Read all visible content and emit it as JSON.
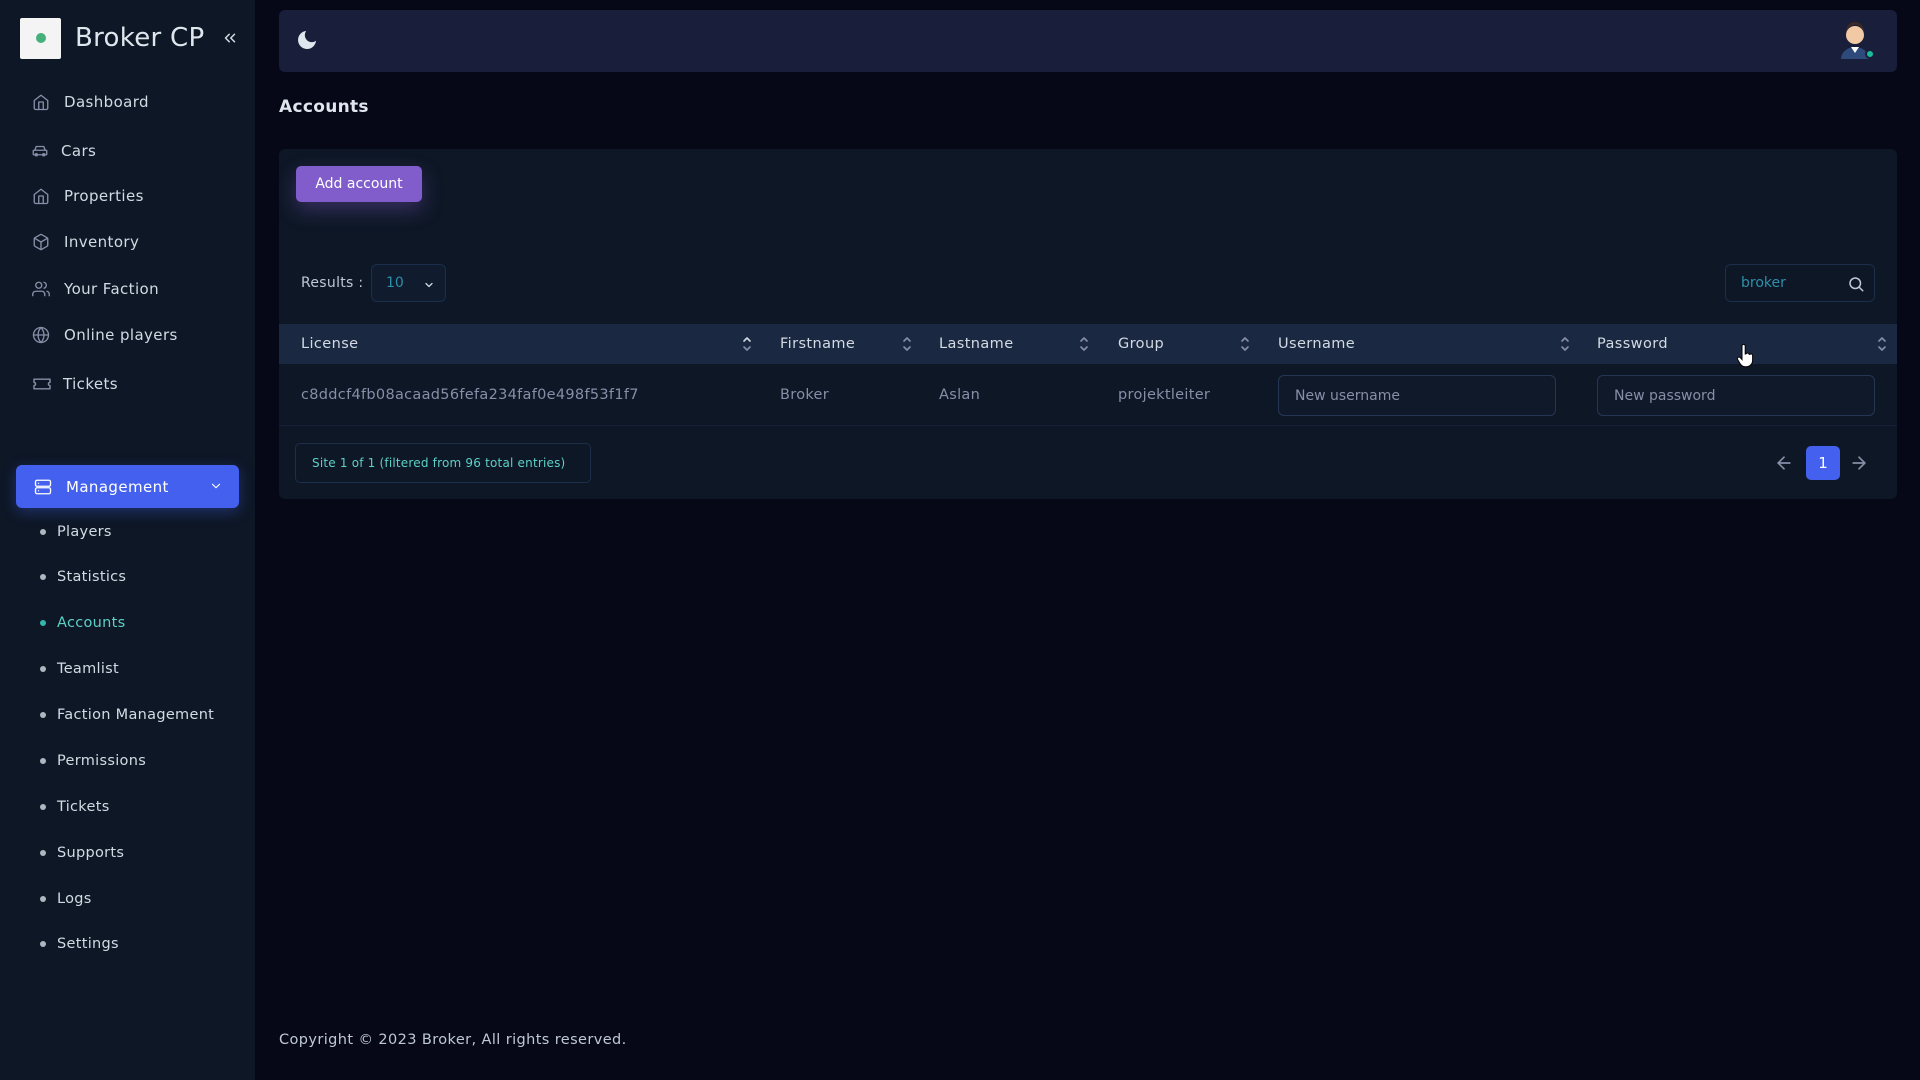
{
  "brand": {
    "name": "Broker CP"
  },
  "sidebar": {
    "items": [
      {
        "label": "Dashboard",
        "icon": "home-icon"
      },
      {
        "label": "Cars",
        "icon": "car-icon"
      },
      {
        "label": "Properties",
        "icon": "home-icon"
      },
      {
        "label": "Inventory",
        "icon": "box-icon"
      },
      {
        "label": "Your Faction",
        "icon": "users-icon"
      },
      {
        "label": "Online players",
        "icon": "globe-icon"
      },
      {
        "label": "Tickets",
        "icon": "ticket-icon"
      }
    ],
    "management": {
      "label": "Management",
      "icon": "server-icon",
      "sub_items": [
        {
          "label": "Players"
        },
        {
          "label": "Statistics"
        },
        {
          "label": "Accounts",
          "active": true
        },
        {
          "label": "Teamlist"
        },
        {
          "label": "Faction Management"
        },
        {
          "label": "Permissions"
        },
        {
          "label": "Tickets"
        },
        {
          "label": "Supports"
        },
        {
          "label": "Logs"
        },
        {
          "label": "Settings"
        }
      ]
    }
  },
  "topbar": {
    "theme_icon": "moon-icon",
    "avatar_icon": "user-avatar-icon"
  },
  "page": {
    "title": "Accounts"
  },
  "panel": {
    "add_button_label": "Add account",
    "results_label": "Results :",
    "results_value": "10",
    "search_value": "broker",
    "columns": [
      "License",
      "Firstname",
      "Lastname",
      "Group",
      "Username",
      "Password"
    ],
    "rows": [
      {
        "license": "c8ddcf4fb08acaad56fefa234faf0e498f53f1f7",
        "firstname": "Broker",
        "lastname": "Aslan",
        "group": "projektleiter",
        "username_placeholder": "New username",
        "password_placeholder": "New password"
      }
    ],
    "info_text": "Site 1 of 1 (filtered from 96 total entries)",
    "current_page": "1"
  },
  "footer": {
    "text": "Copyright © 2023 Broker, All rights reserved."
  },
  "colors": {
    "accent": "#4361ee",
    "button": "#805dca",
    "active": "#5ed0c7",
    "sidebar_bg": "#0e1726",
    "body_bg": "#060818"
  }
}
